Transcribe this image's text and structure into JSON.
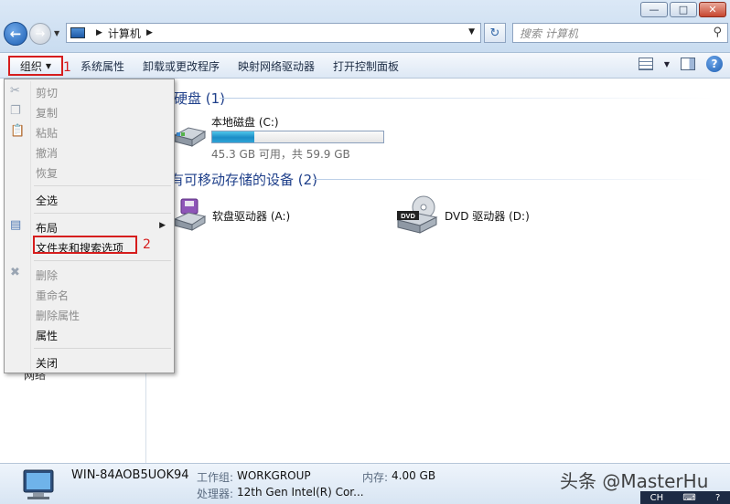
{
  "window": {
    "minimize": "—",
    "maximize": "□",
    "close": "✕"
  },
  "address": {
    "path": "计算机"
  },
  "search": {
    "placeholder": "搜索 计算机"
  },
  "toolbar": {
    "organize": "组织",
    "annot1": "1",
    "links": [
      "系统属性",
      "卸载或更改程序",
      "映射网络驱动器",
      "打开控制面板"
    ]
  },
  "menu": {
    "items": [
      {
        "label": "剪切",
        "disabled": true
      },
      {
        "label": "复制",
        "disabled": true
      },
      {
        "label": "粘贴",
        "disabled": true
      },
      {
        "label": "撤消",
        "disabled": true
      },
      {
        "label": "恢复",
        "disabled": true
      },
      {
        "label": "全选",
        "disabled": false
      },
      {
        "label": "布局",
        "disabled": false
      },
      {
        "label": "文件夹和搜索选项",
        "disabled": false
      },
      {
        "label": "删除",
        "disabled": true
      },
      {
        "label": "重命名",
        "disabled": true
      },
      {
        "label": "删除属性",
        "disabled": true
      },
      {
        "label": "属性",
        "disabled": false
      },
      {
        "label": "关闭",
        "disabled": false
      }
    ],
    "annot2": "2"
  },
  "nav": {
    "network": "网络"
  },
  "content": {
    "hdd_group": "硬盘 (1)",
    "removable_group": "有可移动存储的设备 (2)",
    "drive_c": {
      "name": "本地磁盘 (C:)",
      "space": "45.3 GB 可用，共 59.9 GB",
      "used_fraction": 0.244
    },
    "drive_a": "软盘驱动器 (A:)",
    "drive_d": "DVD 驱动器 (D:)",
    "dvd_badge": "DVD"
  },
  "details": {
    "computer_name": "WIN-84AOB5UOK94",
    "workgroup_label": "工作组:",
    "workgroup": "WORKGROUP",
    "memory_label": "内存:",
    "memory": "4.00 GB",
    "cpu_label": "处理器:",
    "cpu": "12th Gen Intel(R) Cor..."
  },
  "watermark": "头条 @MasterHu",
  "tray": {
    "ime": "CH"
  }
}
